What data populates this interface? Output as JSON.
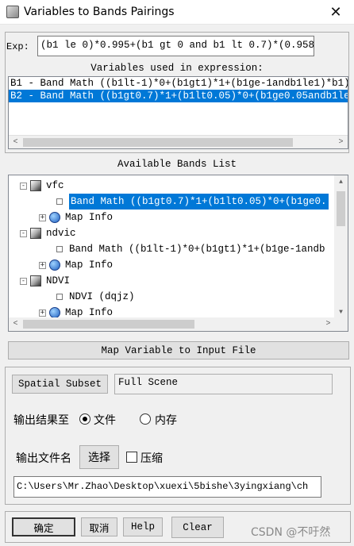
{
  "window": {
    "title": "Variables to Bands Pairings",
    "close_glyph": "✕"
  },
  "expression": {
    "label": "Exp:",
    "value": "(b1 le 0)*0.995+(b1 gt 0 and b1 lt 0.7)*(0.958"
  },
  "variables": {
    "header": "Variables used in expression:",
    "rows": [
      {
        "text": "B1 - Band Math ((b1lt-1)*0+(b1gt1)*1+(b1ge-1andb1le1)*b1)",
        "selected": false
      },
      {
        "text": "B2 - Band Math ((b1gt0.7)*1+(b1lt0.05)*0+(b1ge0.05andb1le",
        "selected": true
      }
    ],
    "scroll_left": "<",
    "scroll_right": ">"
  },
  "bands": {
    "header": "Available Bands List",
    "tree": [
      {
        "kind": "file",
        "label": "vfc",
        "expander": "-"
      },
      {
        "kind": "band",
        "label": "Band Math ((b1gt0.7)*1+(b1lt0.05)*0+(b1ge0.",
        "selected": true
      },
      {
        "kind": "mapinfo",
        "label": "Map Info",
        "expander": "+"
      },
      {
        "kind": "file",
        "label": "ndvic",
        "expander": "-"
      },
      {
        "kind": "band",
        "label": "Band Math ((b1lt-1)*0+(b1gt1)*1+(b1ge-1andb",
        "selected": false
      },
      {
        "kind": "mapinfo",
        "label": "Map Info",
        "expander": "+"
      },
      {
        "kind": "file",
        "label": "NDVI",
        "expander": "-"
      },
      {
        "kind": "band",
        "label": "NDVI (dqjz)",
        "selected": false
      },
      {
        "kind": "mapinfo",
        "label": "Map Info",
        "expander": "+"
      }
    ],
    "scroll_up": "▲",
    "scroll_down": "▼",
    "scroll_left": "<",
    "scroll_right": ">"
  },
  "map_button": "Map Variable to Input File",
  "output": {
    "spatial_subset_button": "Spatial Subset",
    "subset_value": "Full Scene",
    "output_to_label": "输出结果至",
    "radio_file": "文件",
    "radio_memory": "内存",
    "selected_output": "file",
    "filename_label": "输出文件名",
    "choose_button": "选择",
    "compress_label": "压缩",
    "compress_checked": false,
    "path": "C:\\Users\\Mr.Zhao\\Desktop\\xuexi\\5bishe\\3yingxiang\\ch"
  },
  "buttons": {
    "ok": "确定",
    "cancel": "取消",
    "help": "Help",
    "clear": "Clear"
  },
  "watermark": "CSDN @不吁然"
}
